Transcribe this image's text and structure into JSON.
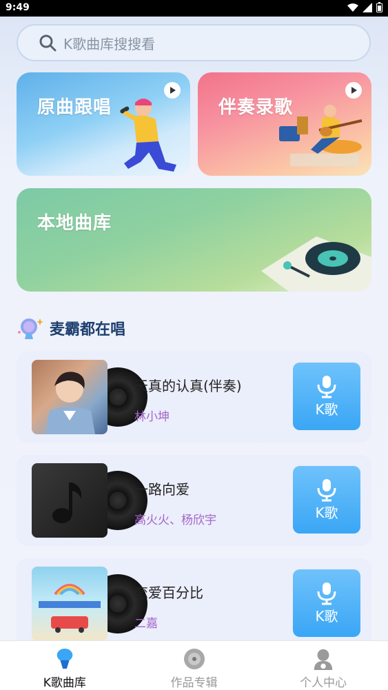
{
  "status_bar": {
    "time": "9:49"
  },
  "search": {
    "placeholder": "K歌曲库搜搜看"
  },
  "cards": {
    "original_sing": "原曲跟唱",
    "accompaniment_record": "伴奏录歌",
    "local_library": "本地曲库"
  },
  "section": {
    "title": "麦霸都在唱"
  },
  "songs": [
    {
      "name": "天真的认真(伴奏)",
      "artist": "林小坤",
      "button": "K歌"
    },
    {
      "name": "一路向爱",
      "artist": "高火火、杨欣宇",
      "button": "K歌"
    },
    {
      "name": "恋爱百分比",
      "artist": "二嘉",
      "button": "K歌"
    }
  ],
  "tabs": [
    {
      "label": "K歌曲库",
      "active": true
    },
    {
      "label": "作品专辑",
      "active": false
    },
    {
      "label": "个人中心",
      "active": false
    }
  ],
  "colors": {
    "accent": "#3aa6f5",
    "artist": "#a565c9",
    "section_title": "#1d3f6e"
  }
}
